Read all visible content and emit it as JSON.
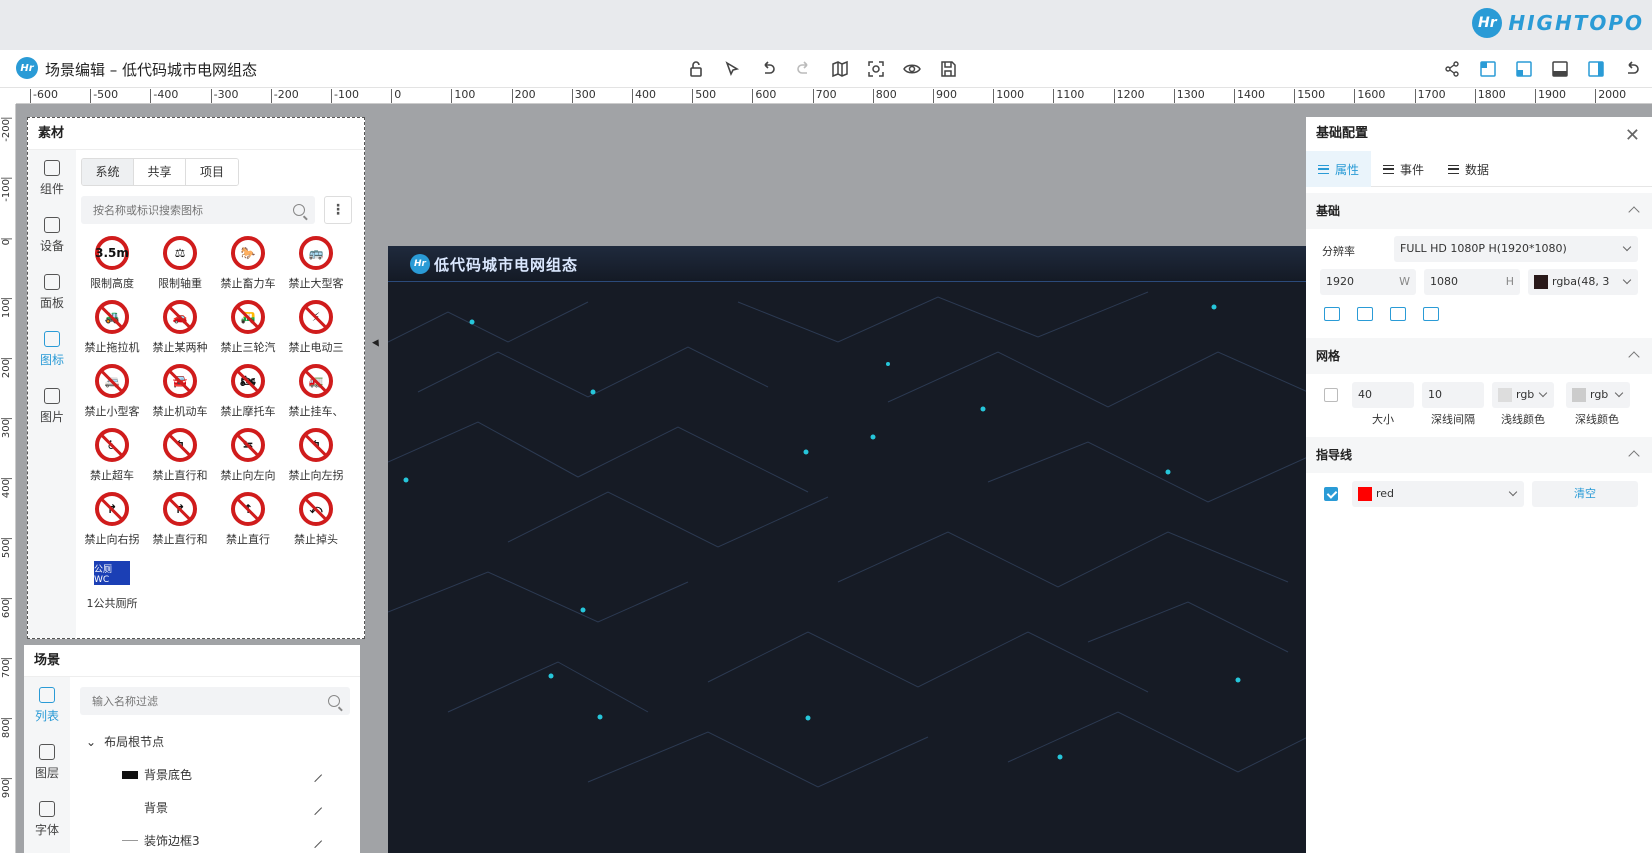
{
  "brand": {
    "logo_text": "Hr",
    "name": "HIGHTOPO"
  },
  "toolbar": {
    "title": "场景编辑 – 低代码城市电网组态",
    "center_tools": [
      "unlock-icon",
      "select-icon",
      "undo-icon",
      "redo-icon",
      "map-icon",
      "focus-icon",
      "preview-icon",
      "save-icon"
    ],
    "right_tools": [
      "share-icon",
      "layout-left-icon",
      "layout-right-icon",
      "layout-bottom-icon",
      "layout-panel-icon",
      "back-icon"
    ]
  },
  "ruler": {
    "h_labels": [
      "-600",
      "-500",
      "-400",
      "-300",
      "-200",
      "-100",
      "0",
      "100",
      "200",
      "300",
      "400",
      "500",
      "600",
      "700",
      "800",
      "900",
      "1000",
      "1100",
      "1200",
      "1300",
      "1400",
      "1500",
      "1600",
      "1700",
      "1800",
      "1900",
      "2000"
    ],
    "v_labels": [
      "-200",
      "-100",
      "0",
      "100",
      "200",
      "300",
      "400",
      "500",
      "600",
      "700",
      "800",
      "900"
    ]
  },
  "scene": {
    "title": "低代码城市电网组态",
    "background_color": "#161b25",
    "accent_color": "#2a9bd6"
  },
  "assets": {
    "title": "素材",
    "side_tabs": [
      {
        "label": "组件",
        "icon": "puzzle-icon"
      },
      {
        "label": "设备",
        "icon": "device-icon"
      },
      {
        "label": "面板",
        "icon": "panel-icon"
      },
      {
        "label": "图标",
        "icon": "shapes-icon",
        "active": true
      },
      {
        "label": "图片",
        "icon": "image-icon"
      }
    ],
    "segments": [
      "系统",
      "共享",
      "项目"
    ],
    "search_placeholder": "按名称或标识搜索图标",
    "items": [
      {
        "label": "限制高度",
        "glyph": "3.5m"
      },
      {
        "label": "限制轴重",
        "glyph": "⚖"
      },
      {
        "label": "禁止畜力车",
        "glyph": "🐎"
      },
      {
        "label": "禁止大型客",
        "glyph": "🚌"
      },
      {
        "label": "禁止拖拉机",
        "glyph": "🚜"
      },
      {
        "label": "禁止某两种",
        "glyph": "🚗"
      },
      {
        "label": "禁止三轮汽",
        "glyph": "🛺"
      },
      {
        "label": "禁止电动三",
        "glyph": "⚡"
      },
      {
        "label": "禁止小型客",
        "glyph": "🚐"
      },
      {
        "label": "禁止机动车",
        "glyph": "🚘"
      },
      {
        "label": "禁止摩托车",
        "glyph": "🏍"
      },
      {
        "label": "禁止挂车、",
        "glyph": "🚛"
      },
      {
        "label": "禁止超车",
        "glyph": "♿"
      },
      {
        "label": "禁止直行和",
        "glyph": "↰"
      },
      {
        "label": "禁止向左向",
        "glyph": "⇆"
      },
      {
        "label": "禁止向左拐",
        "glyph": "↰"
      },
      {
        "label": "禁止向右拐",
        "glyph": "↱"
      },
      {
        "label": "禁止直行和",
        "glyph": "↱"
      },
      {
        "label": "禁止直行",
        "glyph": "↑"
      },
      {
        "label": "禁止掉头",
        "glyph": "⤺"
      }
    ],
    "extra_item": {
      "label": "1公共厕所",
      "glyph": "公厕 WC"
    }
  },
  "scene_panel": {
    "title": "场景",
    "side_tabs": [
      {
        "label": "列表",
        "active": true
      },
      {
        "label": "图层"
      },
      {
        "label": "字体"
      }
    ],
    "search_placeholder": "输入名称过滤",
    "tree": [
      {
        "label": "布局根节点",
        "kind": "root"
      },
      {
        "label": "背景底色",
        "kind": "rect"
      },
      {
        "label": "背景",
        "kind": "image"
      },
      {
        "label": "装饰边框3",
        "kind": "line"
      }
    ]
  },
  "config": {
    "title": "基础配置",
    "tabs": [
      "属性",
      "事件",
      "数据"
    ],
    "basic": {
      "title": "基础",
      "resolution_label": "分辨率",
      "resolution_value": "FULL HD 1080P H(1920*1080)",
      "width": "1920",
      "width_unit": "W",
      "height": "1080",
      "height_unit": "H",
      "bg_color": "rgba(48, 3",
      "bg_swatch": "#2a1a1a"
    },
    "grid": {
      "title": "网格",
      "size": "40",
      "size_label": "大小",
      "interval": "10",
      "interval_label": "深线间隔",
      "light_color": "rgb",
      "light_label": "浅线颜色",
      "dark_color": "rgb",
      "dark_label": "深线颜色"
    },
    "guide": {
      "title": "指导线",
      "color": "red",
      "swatch": "#ff0000",
      "clear_label": "清空"
    }
  }
}
